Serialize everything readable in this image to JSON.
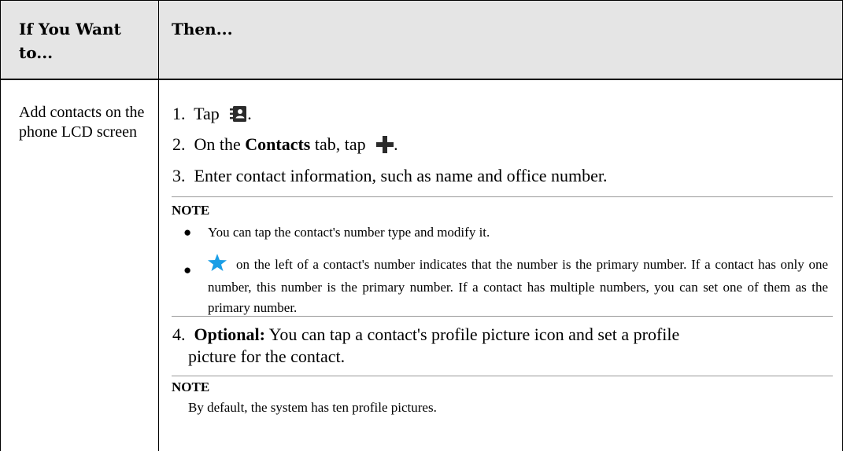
{
  "header": {
    "col1": "If You Want to...",
    "col2": "Then..."
  },
  "row": {
    "action": "Add contacts on the phone LCD screen",
    "step1": {
      "num": "1.",
      "text": "Tap",
      "end": ".",
      "icon": "contacts-book-icon"
    },
    "step2": {
      "num": "2.",
      "pre": "On the",
      "bold": "Contacts",
      "post": "tab, tap",
      "end": ".",
      "icon": "plus-icon"
    },
    "step3": {
      "num": "3.",
      "text": "Enter contact information, such as name and office number."
    },
    "note1": {
      "title": "NOTE",
      "bullet1": "You can tap the contact's number type and modify it.",
      "bullet2": "on the left of a contact's number indicates that the number is the primary number. If a contact has only one number, this number is the primary number. If a contact has multiple numbers, you can set one of them as the primary number.",
      "bullet2_icon": "star-icon",
      "icon_color": "#1a9ee6"
    },
    "step4": {
      "num": "4.",
      "bold": "Optional:",
      "line1": "You can tap a contact's profile picture icon and set a profile",
      "line2": "picture for the contact."
    },
    "note2": {
      "title": "NOTE",
      "text": "By default, the system has ten profile pictures."
    }
  },
  "colors": {
    "header_bg": "#e5e5e5",
    "icon_dark": "#2b2b2b",
    "star": "#1a9ee6"
  }
}
